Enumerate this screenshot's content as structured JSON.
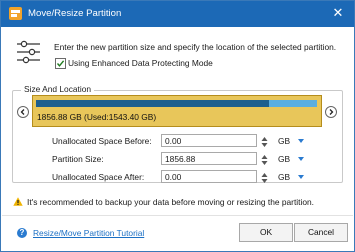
{
  "window": {
    "title": "Move/Resize Partition"
  },
  "instruction": "Enter the new partition size and specify the location of the selected partition.",
  "option": {
    "label": "Using Enhanced Data Protecting Mode",
    "checked": true
  },
  "group": {
    "title": "Size And Location",
    "partition_text": "1856.88 GB (Used:1543.40 GB)",
    "used_fraction": 0.83
  },
  "fields": [
    {
      "label": "Unallocated Space Before:",
      "value": "0.00",
      "unit": "GB"
    },
    {
      "label": "Partition Size:",
      "value": "1856.88",
      "unit": "GB"
    },
    {
      "label": "Unallocated Space After:",
      "value": "0.00",
      "unit": "GB"
    }
  ],
  "warning": "It's recommended to backup your data before moving or resizing the partition.",
  "footer": {
    "tutorial_link": "Resize/Move Partition Tutorial",
    "ok_label": "OK",
    "cancel_label": "Cancel"
  },
  "colors": {
    "titlebar": "#1c69b6",
    "partition": "#e8c65a",
    "used": "#1d5f8e",
    "free": "#5aaee0",
    "link": "#1a6fc4"
  },
  "icons": [
    "app-icon",
    "close-icon",
    "sliders-icon",
    "checkmark-icon",
    "chevron-left-icon",
    "chevron-right-icon",
    "spin-up-icon",
    "spin-down-icon",
    "chevron-down-icon",
    "warning-icon",
    "help-icon"
  ]
}
